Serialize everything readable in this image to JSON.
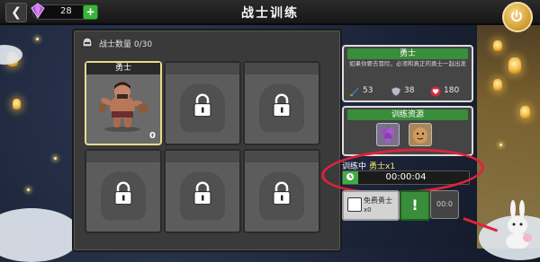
{
  "topbar": {
    "title": "战士训练",
    "currency_value": "28",
    "add_label": "+"
  },
  "left_panel": {
    "count_label": "战士数量 0/30",
    "slots": [
      {
        "name": "勇士",
        "count": "0",
        "state": "active"
      },
      {
        "name": "",
        "state": "locked"
      },
      {
        "name": "",
        "state": "locked"
      },
      {
        "name": "",
        "state": "locked"
      },
      {
        "name": "",
        "state": "locked"
      },
      {
        "name": "",
        "state": "locked"
      }
    ]
  },
  "info_card": {
    "title": "勇士",
    "description": "如果你要去冒险，必须和真正的勇士一起出发",
    "stats": [
      {
        "icon": "sword-icon",
        "value": "53"
      },
      {
        "icon": "shield-icon",
        "value": "38"
      },
      {
        "icon": "heart-icon",
        "value": "180"
      }
    ]
  },
  "resources": {
    "title": "训练资源",
    "items": [
      {
        "icon": "grape-icon"
      },
      {
        "icon": "potato-icon"
      }
    ]
  },
  "training": {
    "status_label": "训练中",
    "unit_label": "勇士x1",
    "time": "00:00:04",
    "progress": 0.12
  },
  "buttons": {
    "free_label": "免费勇士",
    "free_sub": "x0",
    "speed_label": "!",
    "side_label": "00:0"
  },
  "colors": {
    "accent_green": "#3fae3f",
    "highlight_red": "#e0223a",
    "title_green": "#3a8d3a"
  }
}
